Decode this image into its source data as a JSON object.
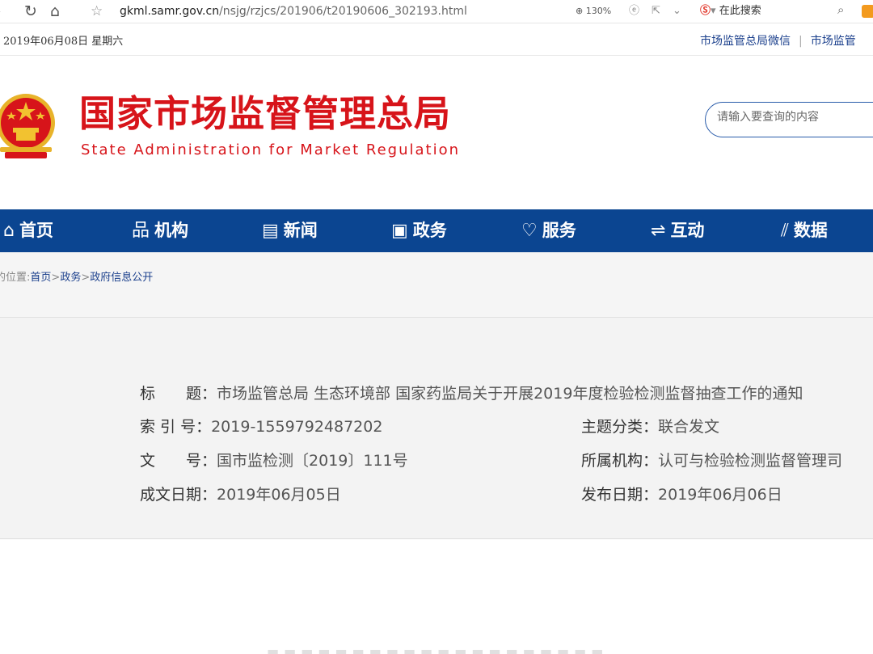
{
  "browser": {
    "url_host": "gkml.samr.gov.cn",
    "url_path": "/nsjg/rzjcs/201906/t20190606_302193.html",
    "zoom": "130%",
    "search_engine_placeholder": "在此搜索"
  },
  "topbar": {
    "date": "2019年06月08日 星期六",
    "links": [
      "市场监管总局微信",
      "市场监管"
    ]
  },
  "header": {
    "title_cn": "国家市场监督管理总局",
    "title_en": "State Administration for Market Regulation",
    "search_placeholder": "请输入要查询的内容"
  },
  "nav": [
    {
      "label": "首页",
      "icon": "home-icon"
    },
    {
      "label": "机构",
      "icon": "org-icon"
    },
    {
      "label": "新闻",
      "icon": "news-icon"
    },
    {
      "label": "政务",
      "icon": "affairs-icon"
    },
    {
      "label": "服务",
      "icon": "heart-icon"
    },
    {
      "label": "互动",
      "icon": "exchange-icon"
    },
    {
      "label": "数据",
      "icon": "chart-icon"
    }
  ],
  "breadcrumb": {
    "prefix": "的位置:",
    "items": [
      "首页",
      "政务",
      "政府信息公开"
    ],
    "sep": ">"
  },
  "meta": {
    "title_label": "标　　题：",
    "title_value": "市场监管总局 生态环境部 国家药监局关于开展2019年度检验检测监督抽查工作的通知",
    "index_label": "索 引 号：",
    "index_value": "2019-1559792487202",
    "topic_label": "主题分类：",
    "topic_value": "联合发文",
    "docno_label": "文　　号：",
    "docno_value": "国市监检测〔2019〕111号",
    "org_label": "所属机构：",
    "org_value": "认可与检验检测监督管理司",
    "created_label": "成文日期：",
    "created_value": "2019年06月05日",
    "published_label": "发布日期：",
    "published_value": "2019年06月06日"
  },
  "colors": {
    "brand_red": "#d7141a",
    "nav_blue": "#0b4591",
    "link_blue": "#1a3f8c"
  }
}
